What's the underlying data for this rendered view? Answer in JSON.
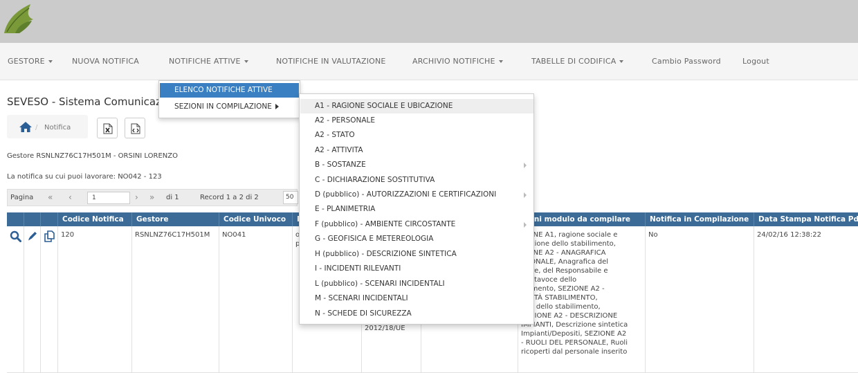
{
  "nav": {
    "items": [
      {
        "label": "GESTORE",
        "dropdown": true
      },
      {
        "label": "NUOVA NOTIFICA",
        "dropdown": false
      },
      {
        "label": "NOTIFICHE ATTIVE",
        "dropdown": true
      },
      {
        "label": "NOTIFICHE IN VALUTAZIONE",
        "dropdown": false
      },
      {
        "label": "ARCHIVIO NOTIFICHE",
        "dropdown": true
      },
      {
        "label": "TABELLE DI CODIFICA",
        "dropdown": true
      },
      {
        "label": "Cambio Password",
        "dropdown": false
      },
      {
        "label": "Logout",
        "dropdown": false
      }
    ]
  },
  "page": {
    "title": "SEVESO - Sistema Comunicazi",
    "breadcrumb": "Notifica",
    "breadcrumb_sep": "/",
    "gestore_line": "Gestore RSNLNZ76C17H501M - ORSINI LORENZO",
    "notifica_line": "La notifica su cui puoi lavorare: NO042 - 123"
  },
  "pager": {
    "label": "Pagina",
    "first": "«",
    "prev": "‹",
    "page_value": "1",
    "next": "›",
    "last": "»",
    "of": "di 1",
    "records": "Record 1 a 2 di 2",
    "page_size": "50"
  },
  "table": {
    "headers": [
      "Codice Notifica",
      "Gestore",
      "Codice Univoco",
      "P",
      "zioni modulo da compilare",
      "Notifica in Compilazione",
      "Data Stampa Notifica Pdf"
    ],
    "row": {
      "codice_notifica": "120",
      "gestore": "RSNLNZ76C17H501M",
      "codice_univoco": "NO041",
      "p_col": "o\np",
      "directive": "2012/18/UE",
      "sezioni": "ZIONE A1, ragione sociale e\nicazione dello stabilimento,\nZIONE A2 - ANAGRAFICA\nRSONALE, Anagrafica del\nstore, del Responsabile e\n Portavoce dello\nbilimento, SEZIONE A2 -\nTIVITÀ STABILIMENTO,\nvità dello stabilimento,\nSEZIONE A2 - DESCRIZIONE\nIMPIANTI, Descrizione sintetica\nImpianti/Depositi, SEZIONE A2\n- RUOLI DEL PERSONALE, Ruoli\nricoperti dal personale inserito",
      "in_compilazione": "No",
      "data_stampa": "24/02/16 12:38:22"
    }
  },
  "menu_notifiche_attive": {
    "items": [
      "ELENCO NOTIFICHE ATTIVE",
      "SEZIONI IN COMPILAZIONE"
    ]
  },
  "menu_sezioni": {
    "items": [
      {
        "label": "A1 - RAGIONE SOCIALE E UBICAZIONE",
        "submenu": false
      },
      {
        "label": "A2 - PERSONALE",
        "submenu": false
      },
      {
        "label": "A2 - STATO",
        "submenu": false
      },
      {
        "label": "A2 - ATTIVITA",
        "submenu": false
      },
      {
        "label": "B - SOSTANZE",
        "submenu": true
      },
      {
        "label": "C - DICHIARAZIONE SOSTITUTIVA",
        "submenu": false
      },
      {
        "label": "D (pubblico) - AUTORIZZAZIONI E CERTIFICAZIONI",
        "submenu": true
      },
      {
        "label": "E - PLANIMETRIA",
        "submenu": false
      },
      {
        "label": "F (pubblico) - AMBIENTE CIRCOSTANTE",
        "submenu": true
      },
      {
        "label": "G - GEOFISICA E METEREOLOGIA",
        "submenu": false
      },
      {
        "label": "H (pubblico) - DESCRIZIONE SINTETICA",
        "submenu": false
      },
      {
        "label": "I - INCIDENTI RILEVANTI",
        "submenu": false
      },
      {
        "label": "L (pubblico) - SCENARI INCIDENTALI",
        "submenu": false
      },
      {
        "label": "M - SCENARI INCIDENTALI",
        "submenu": false
      },
      {
        "label": "N - SCHEDE DI SICUREZZA",
        "submenu": false
      }
    ]
  },
  "colors": {
    "accent": "#3a7fc1",
    "table_header": "#3b6b96",
    "icon_blue": "#2b5f95"
  }
}
